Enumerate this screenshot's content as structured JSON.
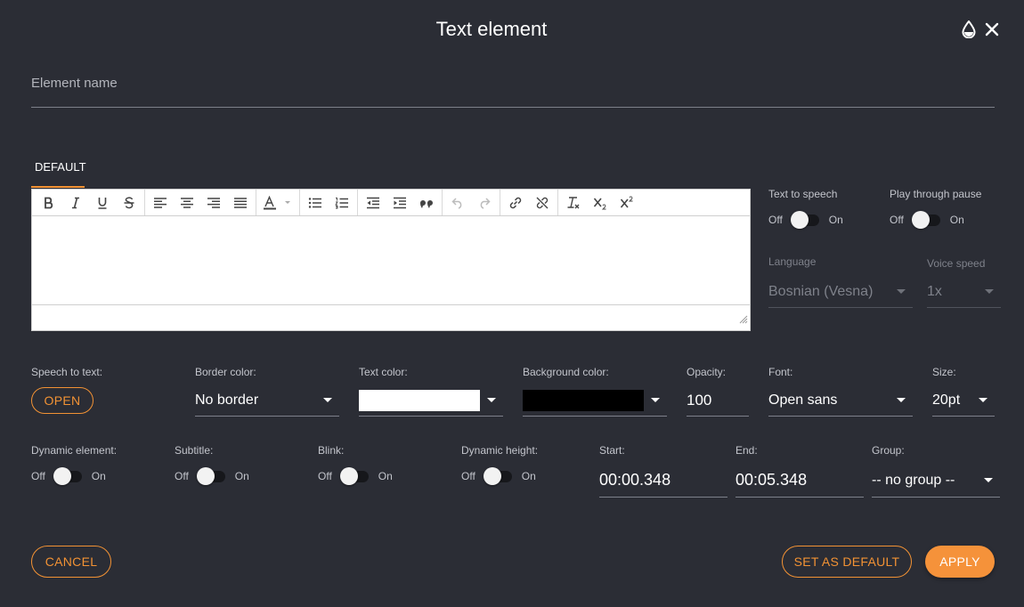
{
  "dialog": {
    "title": "Text element"
  },
  "name_field": {
    "placeholder": "Element name"
  },
  "tabs": {
    "default": "DEFAULT"
  },
  "tts": {
    "text_to_speech": {
      "label": "Text to speech",
      "off": "Off",
      "on": "On"
    },
    "play_through_pause": {
      "label": "Play through pause",
      "off": "Off",
      "on": "On"
    },
    "language": {
      "label": "Language",
      "value": "Bosnian (Vesna)"
    },
    "voice_speed": {
      "label": "Voice speed",
      "value": "1x"
    }
  },
  "style": {
    "speech_to_text": {
      "label": "Speech to text:",
      "button": "OPEN"
    },
    "border_color": {
      "label": "Border color:",
      "value": "No border"
    },
    "text_color": {
      "label": "Text color:",
      "swatch": "#ffffff"
    },
    "background_color": {
      "label": "Background color:",
      "swatch": "#000000"
    },
    "opacity": {
      "label": "Opacity:",
      "value": "100"
    },
    "font": {
      "label": "Font:",
      "value": "Open sans"
    },
    "size": {
      "label": "Size:",
      "value": "20pt"
    }
  },
  "toggles": [
    {
      "label": "Dynamic element:",
      "off": "Off",
      "on": "On"
    },
    {
      "label": "Subtitle:",
      "off": "Off",
      "on": "On"
    },
    {
      "label": "Blink:",
      "off": "Off",
      "on": "On"
    },
    {
      "label": "Dynamic height:",
      "off": "Off",
      "on": "On"
    }
  ],
  "timing": {
    "start": {
      "label": "Start:",
      "value": "00:00.348"
    },
    "end": {
      "label": "End:",
      "value": "00:05.348"
    },
    "group": {
      "label": "Group:",
      "value": "-- no group --"
    }
  },
  "buttons": {
    "cancel": "CANCEL",
    "set_default": "SET AS DEFAULT",
    "apply": "APPLY"
  },
  "colors": {
    "accent": "#f29234",
    "background": "#2b2d35"
  }
}
